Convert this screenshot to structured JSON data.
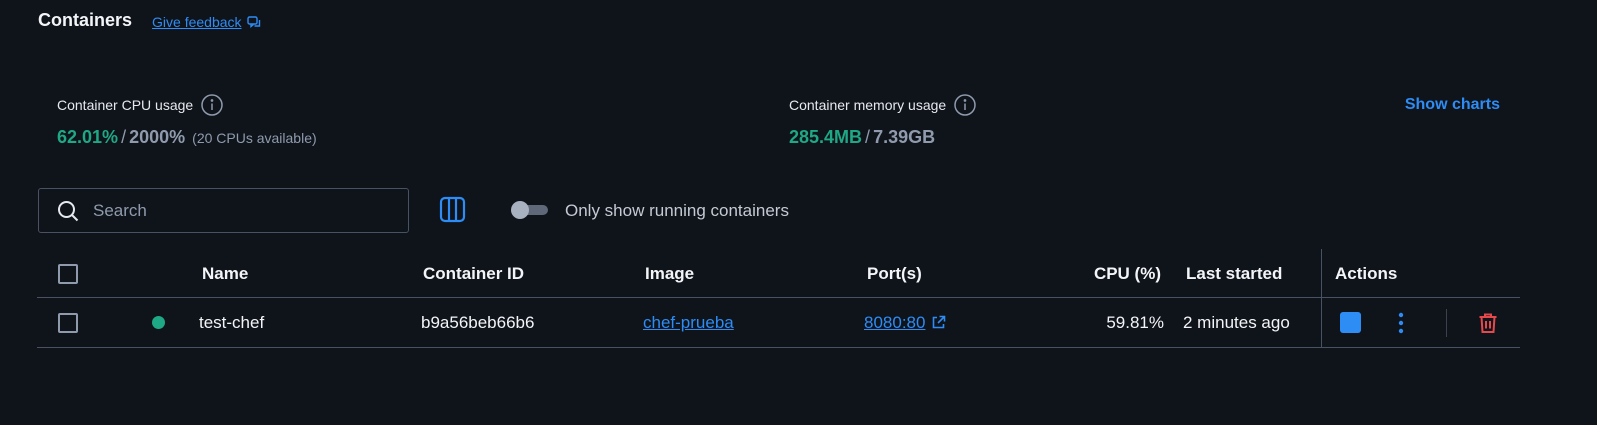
{
  "header": {
    "title": "Containers",
    "feedback_label": "Give feedback"
  },
  "stats": {
    "cpu": {
      "label": "Container CPU usage",
      "used": "62.01%",
      "separator": "/",
      "total": "2000%",
      "available": "(20 CPUs available)"
    },
    "memory": {
      "label": "Container memory usage",
      "used": "285.4MB",
      "separator": "/",
      "total": "7.39GB"
    },
    "show_charts_label": "Show charts"
  },
  "toolbar": {
    "search_placeholder": "Search",
    "toggle_label": "Only show running containers",
    "toggle_on": false
  },
  "table": {
    "columns": {
      "name": "Name",
      "container_id": "Container ID",
      "image": "Image",
      "ports": "Port(s)",
      "cpu": "CPU (%)",
      "last_started": "Last started",
      "actions": "Actions"
    },
    "rows": [
      {
        "status": "running",
        "name": "test-chef",
        "container_id": "b9a56beb66b6",
        "image": "chef-prueba",
        "ports": "8080:80",
        "cpu": "59.81%",
        "last_started": "2 minutes ago"
      }
    ]
  },
  "colors": {
    "background": "#0f131a",
    "accent": "#2e8cf5",
    "running": "#1fa885",
    "danger": "#e5484d"
  },
  "icons": {
    "feedback": "chat-bubble-icon",
    "info": "info-circle-icon",
    "search": "search-icon",
    "columns": "columns-icon",
    "external_link": "external-link-icon",
    "stop": "stop-icon",
    "more": "kebab-menu-icon",
    "delete": "trash-icon"
  }
}
